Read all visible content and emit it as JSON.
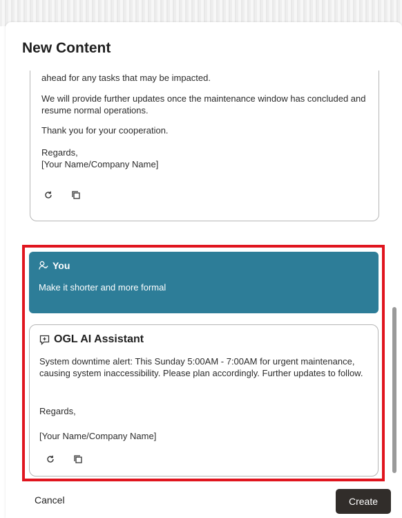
{
  "dialog": {
    "title": "New Content",
    "cancel_label": "Cancel",
    "create_label": "Create"
  },
  "previous_response": {
    "paragraphs": [
      "ahead for any tasks that may be impacted.",
      "We will provide further updates once the maintenance window has concluded and resume normal operations.",
      "Thank you for your cooperation.",
      "Regards,\n[Your Name/Company Name]"
    ]
  },
  "user_message": {
    "author": "You",
    "text": "Make it shorter and more formal"
  },
  "ai_response": {
    "author": "OGL AI Assistant",
    "paragraphs": [
      "System downtime alert: This Sunday 5:00AM - 7:00AM for urgent maintenance, causing system inaccessibility. Please plan accordingly. Further updates to follow.",
      "Regards,",
      "[Your Name/Company Name]"
    ]
  },
  "icons": {
    "regenerate": "refresh-icon",
    "copy": "copy-icon",
    "user": "user-icon",
    "assistant": "chat-assistant-icon"
  },
  "colors": {
    "user_bubble": "#2d7d98",
    "highlight_border": "#e0151e",
    "primary_button": "#312d2a"
  }
}
